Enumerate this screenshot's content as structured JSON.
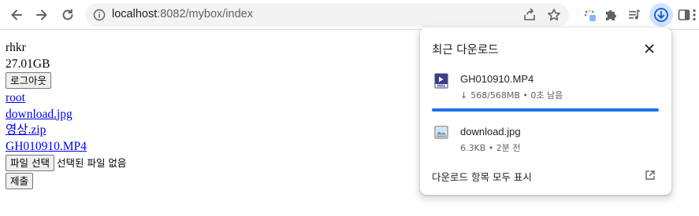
{
  "toolbar": {
    "url_host": "localhost",
    "url_rest": ":8082/mybox/index",
    "icons": [
      "back-arrow-icon",
      "forward-arrow-icon",
      "reload-icon",
      "info-icon",
      "share-icon",
      "star-icon",
      "extension-icon",
      "puzzle-icon",
      "media-control-icon",
      "download-icon",
      "side-panel-icon",
      "more-vert-icon"
    ],
    "accent_color": "#1a73e8"
  },
  "page": {
    "username": "rhkr",
    "storage": "27.01GB",
    "logout_label": "로그아웃",
    "links": [
      "root",
      "download.jpg",
      "영상.zip",
      "GH010910.MP4"
    ],
    "choose_file_label": "파일 선택",
    "no_file_text": "선택된 파일 없음",
    "submit_label": "제출"
  },
  "downloads": {
    "title": "최근 다운로드",
    "items": [
      {
        "name": "GH010910.MP4",
        "status": "568/568MB • 0초 남음",
        "progress": 1.0,
        "icon": "video-file-icon"
      },
      {
        "name": "download.jpg",
        "status": "6.3KB • 2분 전",
        "icon": "image-file-icon"
      }
    ],
    "show_all_label": "다운로드 항목 모두 표시"
  }
}
